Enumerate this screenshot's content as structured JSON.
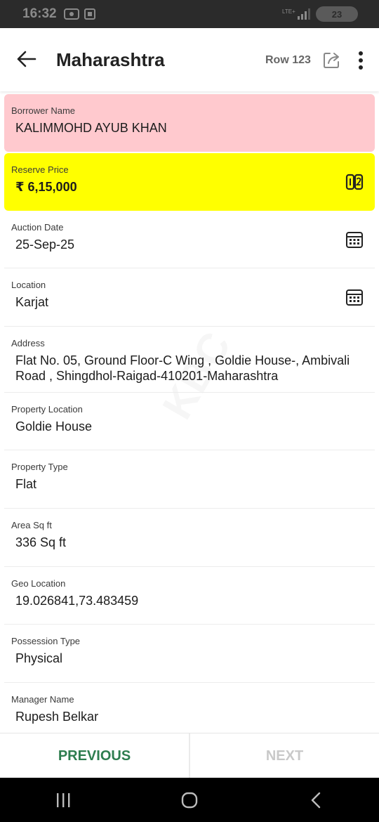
{
  "status_bar": {
    "time": "16:32",
    "battery": "23"
  },
  "header": {
    "title": "Maharashtra",
    "row_label": "Row 123"
  },
  "fields": {
    "borrower": {
      "label": "Borrower Name",
      "value": "KALIMMOHD AYUB KHAN"
    },
    "reserve": {
      "label": "Reserve Price",
      "value": "₹ 6,15,000"
    },
    "auction": {
      "label": "Auction Date",
      "value": "25-Sep-25"
    },
    "location": {
      "label": "Location",
      "value": "Karjat"
    },
    "address": {
      "label": "Address",
      "value": "Flat No. 05, Ground Floor-C Wing , Goldie House-, Ambivali Road , Shingdhol-Raigad-410201-Maharashtra"
    },
    "property_location": {
      "label": "Property Location",
      "value": "Goldie House"
    },
    "property_type": {
      "label": "Property Type",
      "value": "Flat"
    },
    "area": {
      "label": "Area Sq ft",
      "value": "336 Sq ft"
    },
    "geo": {
      "label": "Geo Location",
      "value": "19.026841,73.483459"
    },
    "possession": {
      "label": "Possession Type",
      "value": "Physical"
    },
    "manager": {
      "label": "Manager Name",
      "value": "Rupesh Belkar"
    }
  },
  "nav": {
    "previous": "PREVIOUS",
    "next": "NEXT"
  },
  "colors": {
    "borrower_bg": "#ffc9ce",
    "reserve_bg": "#ffff00",
    "accent_green": "#2e7d4f",
    "disabled_gray": "#c9c9c9"
  },
  "icons": {
    "back": "arrow-left-icon",
    "share": "share-icon",
    "menu": "more-vert-icon",
    "reserve": "number-format-icon",
    "calendar": "calendar-icon"
  }
}
